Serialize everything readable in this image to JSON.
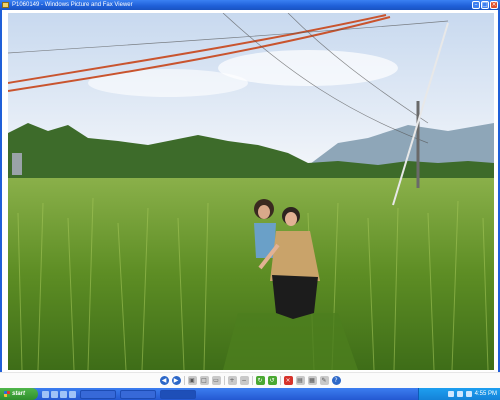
{
  "window": {
    "title": "P1060149 - Windows Picture and Fax Viewer",
    "buttons": [
      "minimize",
      "maximize",
      "close"
    ]
  },
  "photo": {
    "subject": "two women crouching in a green rice paddy under power lines with trees and mountains in the background",
    "colors": {
      "sky": "#dfe9f6",
      "rice": "#6c9a2a",
      "trees": "#3d6b2a",
      "mountains": "#8aa4b8",
      "wires": "#c9542e"
    }
  },
  "toolbar": {
    "icons": [
      "previous-icon",
      "next-icon",
      "best-fit-icon",
      "actual-size-icon",
      "slideshow-icon",
      "zoom-in-icon",
      "zoom-out-icon",
      "rotate-clockwise-icon",
      "rotate-counterclockwise-icon",
      "delete-icon",
      "print-icon",
      "copy-to-icon",
      "edit-icon",
      "help-icon"
    ]
  },
  "taskbar": {
    "start_label": "start",
    "clock": "4:55 PM"
  }
}
